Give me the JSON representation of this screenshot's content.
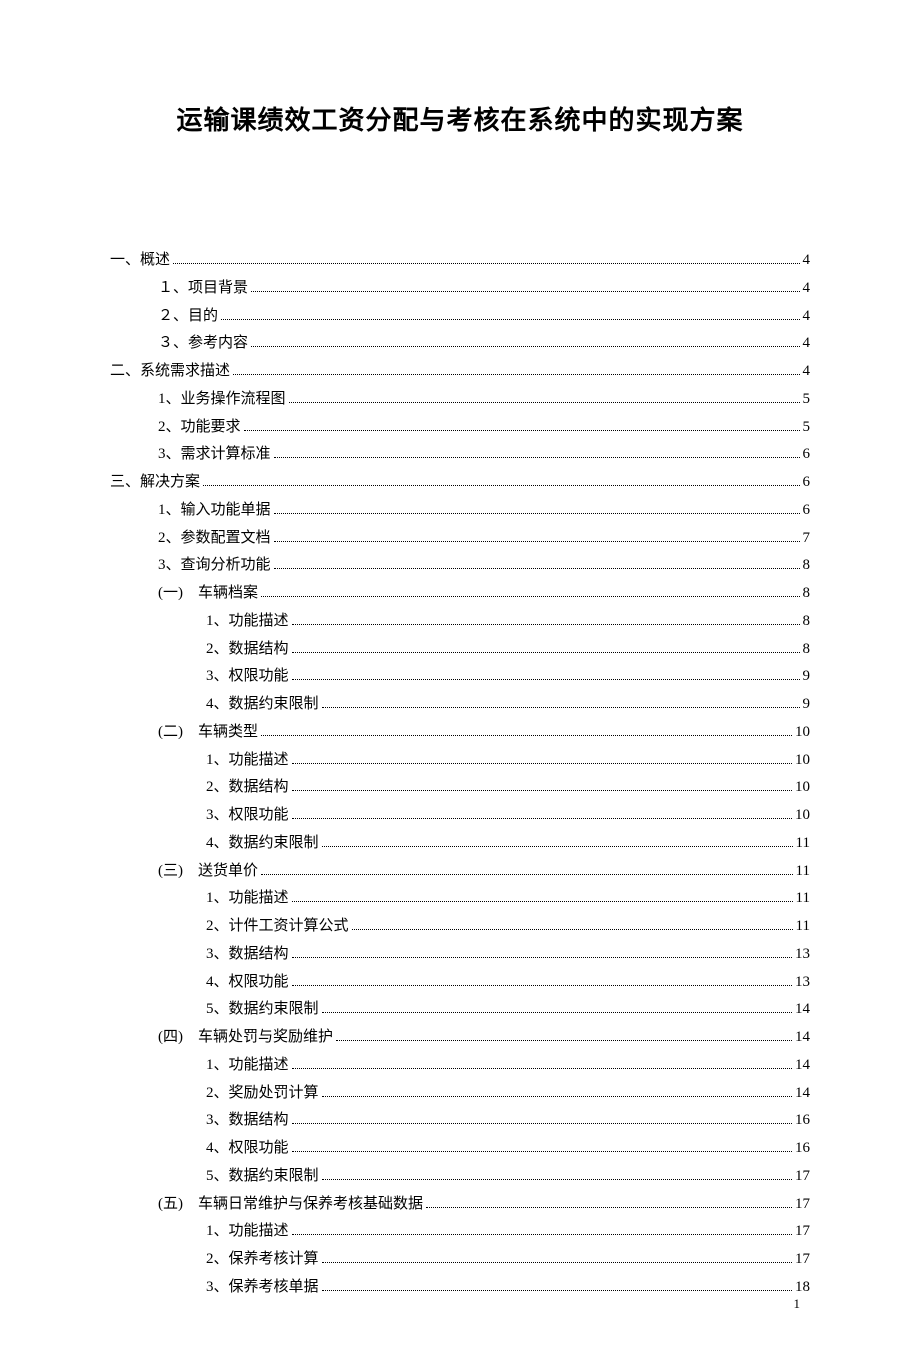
{
  "title": "运输课绩效工资分配与考核在系统中的实现方案",
  "page_number": "1",
  "toc": [
    {
      "level": 1,
      "label": "一、概述",
      "page": "4"
    },
    {
      "level": 2,
      "label": "１、项目背景",
      "page": "4"
    },
    {
      "level": 2,
      "label": "２、目的",
      "page": "4"
    },
    {
      "level": 2,
      "label": "３、参考内容",
      "page": "4"
    },
    {
      "level": 1,
      "label": "二、系统需求描述",
      "page": "4"
    },
    {
      "level": 2,
      "label": "1、业务操作流程图",
      "page": "5"
    },
    {
      "level": 2,
      "label": "2、功能要求",
      "page": "5"
    },
    {
      "level": 2,
      "label": "3、需求计算标准",
      "page": "6"
    },
    {
      "level": 1,
      "label": "三、解决方案",
      "page": "6"
    },
    {
      "level": 2,
      "label": "1、输入功能单据",
      "page": "6"
    },
    {
      "level": 2,
      "label": "2、参数配置文档",
      "page": "7"
    },
    {
      "level": 2,
      "label": "3、查询分析功能",
      "page": "8"
    },
    {
      "level": 3,
      "label": "(一)　车辆档案",
      "page": "8"
    },
    {
      "level": 4,
      "label": "1、功能描述",
      "page": "8"
    },
    {
      "level": 4,
      "label": "2、数据结构",
      "page": "8"
    },
    {
      "level": 4,
      "label": "3、权限功能",
      "page": "9"
    },
    {
      "level": 4,
      "label": "4、数据约束限制",
      "page": "9"
    },
    {
      "level": 3,
      "label": "(二)　车辆类型",
      "page": "10"
    },
    {
      "level": 4,
      "label": "1、功能描述",
      "page": "10"
    },
    {
      "level": 4,
      "label": "2、数据结构",
      "page": "10"
    },
    {
      "level": 4,
      "label": "3、权限功能",
      "page": "10"
    },
    {
      "level": 4,
      "label": "4、数据约束限制",
      "page": "11"
    },
    {
      "level": 3,
      "label": "(三)　送货单价",
      "page": "11"
    },
    {
      "level": 4,
      "label": "1、功能描述",
      "page": "11"
    },
    {
      "level": 4,
      "label": "2、计件工资计算公式",
      "page": "11"
    },
    {
      "level": 4,
      "label": "3、数据结构",
      "page": "13"
    },
    {
      "level": 4,
      "label": "4、权限功能",
      "page": "13"
    },
    {
      "level": 4,
      "label": "5、数据约束限制",
      "page": "14"
    },
    {
      "level": 3,
      "label": "(四)　车辆处罚与奖励维护",
      "page": "14"
    },
    {
      "level": 4,
      "label": "1、功能描述",
      "page": "14"
    },
    {
      "level": 4,
      "label": "2、奖励处罚计算",
      "page": "14"
    },
    {
      "level": 4,
      "label": "3、数据结构",
      "page": "16"
    },
    {
      "level": 4,
      "label": "4、权限功能",
      "page": "16"
    },
    {
      "level": 4,
      "label": "5、数据约束限制",
      "page": "17"
    },
    {
      "level": 3,
      "label": "(五)　车辆日常维护与保养考核基础数据",
      "page": "17"
    },
    {
      "level": 4,
      "label": "1、功能描述",
      "page": "17"
    },
    {
      "level": 4,
      "label": "2、保养考核计算",
      "page": "17"
    },
    {
      "level": 4,
      "label": "3、保养考核单据",
      "page": "18"
    }
  ]
}
